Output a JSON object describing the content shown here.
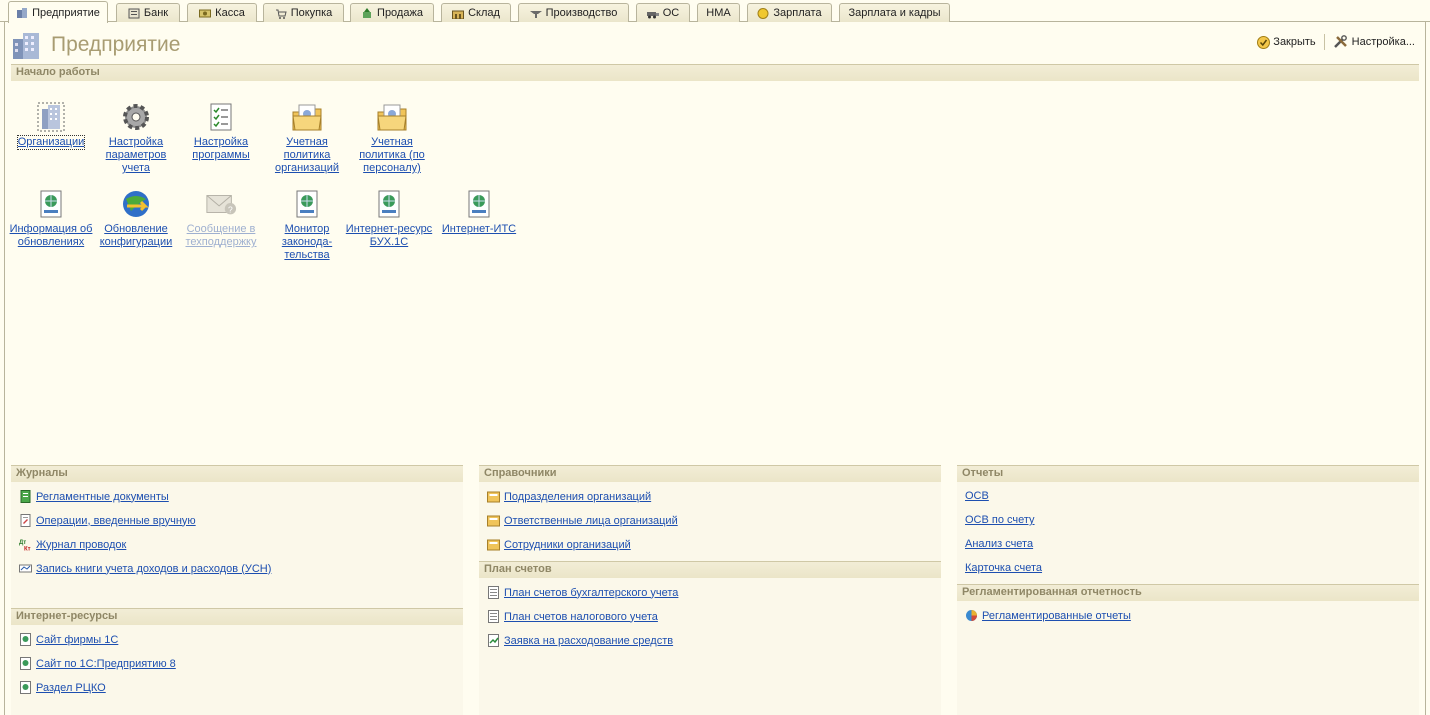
{
  "tabs": [
    {
      "label": "Предприятие",
      "icon": "enterprise-icon"
    },
    {
      "label": "Банк",
      "icon": "bank-icon"
    },
    {
      "label": "Касса",
      "icon": "cash-icon"
    },
    {
      "label": "Покупка",
      "icon": "purchase-icon"
    },
    {
      "label": "Продажа",
      "icon": "sale-icon"
    },
    {
      "label": "Склад",
      "icon": "warehouse-icon"
    },
    {
      "label": "Производство",
      "icon": "production-icon"
    },
    {
      "label": "ОС",
      "icon": "fixed-assets-icon"
    },
    {
      "label": "НМА",
      "icon": ""
    },
    {
      "label": "Зарплата",
      "icon": "salary-icon"
    },
    {
      "label": "Зарплата и кадры",
      "icon": ""
    }
  ],
  "page": {
    "title": "Предприятие",
    "close_label": "Закрыть",
    "settings_label": "Настройка..."
  },
  "start": {
    "heading": "Начало работы",
    "tiles": [
      {
        "label": "Организации",
        "icon": "building-icon"
      },
      {
        "label": "Настройка параметров учета",
        "icon": "gear-icon"
      },
      {
        "label": "Настройка программы",
        "icon": "checklist-icon"
      },
      {
        "label": "Учетная политика организаций",
        "icon": "policy-folder-icon"
      },
      {
        "label": "Учетная политика (по персоналу)",
        "icon": "policy-folder-icon"
      },
      {
        "label": "Информация об обновлениях",
        "icon": "web-doc-icon"
      },
      {
        "label": "Обновление конфигурации",
        "icon": "globe-update-icon"
      },
      {
        "label": "Сообщение в техподдержку",
        "icon": "envelope-question-icon"
      },
      {
        "label": "Монитор законода-тельства",
        "icon": "web-doc-icon"
      },
      {
        "label": "Интернет-ресурс БУХ.1С",
        "icon": "web-doc-icon"
      },
      {
        "label": "Интернет-ИТС",
        "icon": "web-doc-icon"
      }
    ]
  },
  "journals": {
    "heading": "Журналы",
    "items": [
      "Регламентные документы",
      "Операции, введенные вручную",
      "Журнал проводок",
      "Запись книги учета доходов и расходов (УСН)"
    ]
  },
  "internet": {
    "heading": "Интернет-ресурсы",
    "items": [
      "Сайт фирмы 1С",
      "Сайт по 1С:Предприятию 8",
      "Раздел РЦКО"
    ]
  },
  "catalogs": {
    "heading": "Справочники",
    "items": [
      "Подразделения организаций",
      "Ответственные лица организаций",
      "Сотрудники организаций"
    ]
  },
  "accounts": {
    "heading": "План счетов",
    "items": [
      "План счетов бухгалтерского учета",
      "План счетов налогового учета",
      "Заявка на расходование средств"
    ]
  },
  "reports": {
    "heading": "Отчеты",
    "items": [
      "ОСВ",
      "ОСВ по счету",
      "Анализ счета",
      "Карточка счета"
    ]
  },
  "regulated": {
    "heading": "Регламентированная отчетность",
    "items": [
      "Регламентированные отчеты"
    ]
  },
  "colors": {
    "link": "#1d4fb0",
    "heading": "#8f8766",
    "panel_bg": "#fbf8ea",
    "page_bg": "#fffdf0"
  }
}
